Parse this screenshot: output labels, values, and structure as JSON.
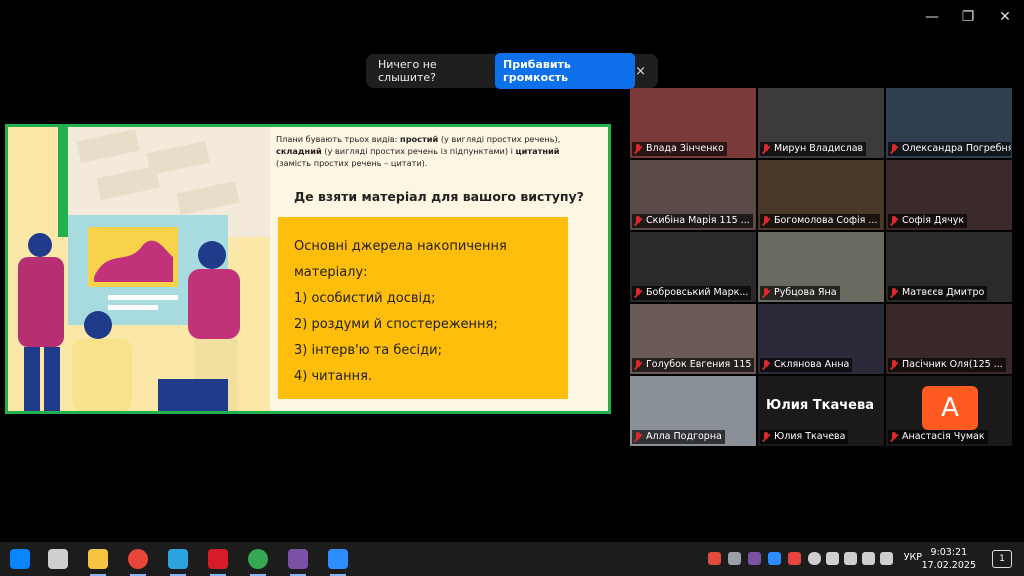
{
  "window": {
    "minimize": "—",
    "restore": "❐",
    "close": "✕"
  },
  "notification": {
    "message": "Ничего не слышите?",
    "button": "Прибавить громкость",
    "close": "×"
  },
  "slide": {
    "intro_1": "Плани бувають трьох видів: ",
    "intro_simple": "простий",
    "intro_2": " (у вигляді простих речень),",
    "intro_complex": "складний",
    "intro_3": " (у вигляді простих речень із підпунктами) і ",
    "intro_quote": "цитатний",
    "intro_4": " (замість простих речень – цитати).",
    "question": "Де взяти матеріал для вашого виступу?",
    "box_lines": [
      "Основні джерела накопичення",
      "матеріалу:",
      "1) особистий досвід;",
      "2) роздуми й спостереження;",
      "3) інтерв'ю та бесіди;",
      "4) читання."
    ]
  },
  "participants": [
    {
      "name": "Влада Зінченко",
      "color": "#7a3a3a"
    },
    {
      "name": "Мирун Владислав",
      "color": "#3b3b3b"
    },
    {
      "name": "Олександра Погребняк",
      "color": "#2f3f4f"
    },
    {
      "name": "Скибіна Марія 115 ...",
      "color": "#5a4a48"
    },
    {
      "name": "Богомолова Софія ...",
      "color": "#4a3828"
    },
    {
      "name": "Софія Дячук",
      "color": "#3a2a2a"
    },
    {
      "name": "Бобровський Марк...",
      "color": "#2a2a2a"
    },
    {
      "name": "Рубцова Яна",
      "color": "#6a6a60"
    },
    {
      "name": "Матвєєв Дмитро",
      "color": "#2a2a2a"
    },
    {
      "name": "Голубок Евгения 115",
      "color": "#6a5a58"
    },
    {
      "name": "Склянова Анна",
      "color": "#2a2a38"
    },
    {
      "name": "Пасічник Оля(125 ...",
      "color": "#3a2828"
    },
    {
      "name": "Алла Подгорна",
      "color": "#8a9098"
    },
    {
      "name": "Юлия Ткачева",
      "color": "#1a1a1a",
      "big": "Юлия Ткачева"
    },
    {
      "name": "Анастасія Чумак",
      "color": "#1a1a1a",
      "avatar": "А"
    }
  ],
  "taskbar": {
    "lang": "УКР",
    "time": "9:03:21",
    "date": "17.02.2025",
    "notif_count": "1",
    "icons": [
      {
        "name": "windows-start-icon",
        "color": "#0a84ff"
      },
      {
        "name": "task-view-icon",
        "color": "#cfcfcf"
      },
      {
        "name": "file-explorer-icon",
        "color": "#f5c542"
      },
      {
        "name": "chrome-icon",
        "color": "#e8453c"
      },
      {
        "name": "telegram-icon",
        "color": "#2aa3df"
      },
      {
        "name": "opera-icon",
        "color": "#d81b2b"
      },
      {
        "name": "chrome-alt-icon",
        "color": "#34a853"
      },
      {
        "name": "viber-icon",
        "color": "#7b51a6"
      },
      {
        "name": "zoom-icon",
        "color": "#2d8cff"
      }
    ]
  }
}
